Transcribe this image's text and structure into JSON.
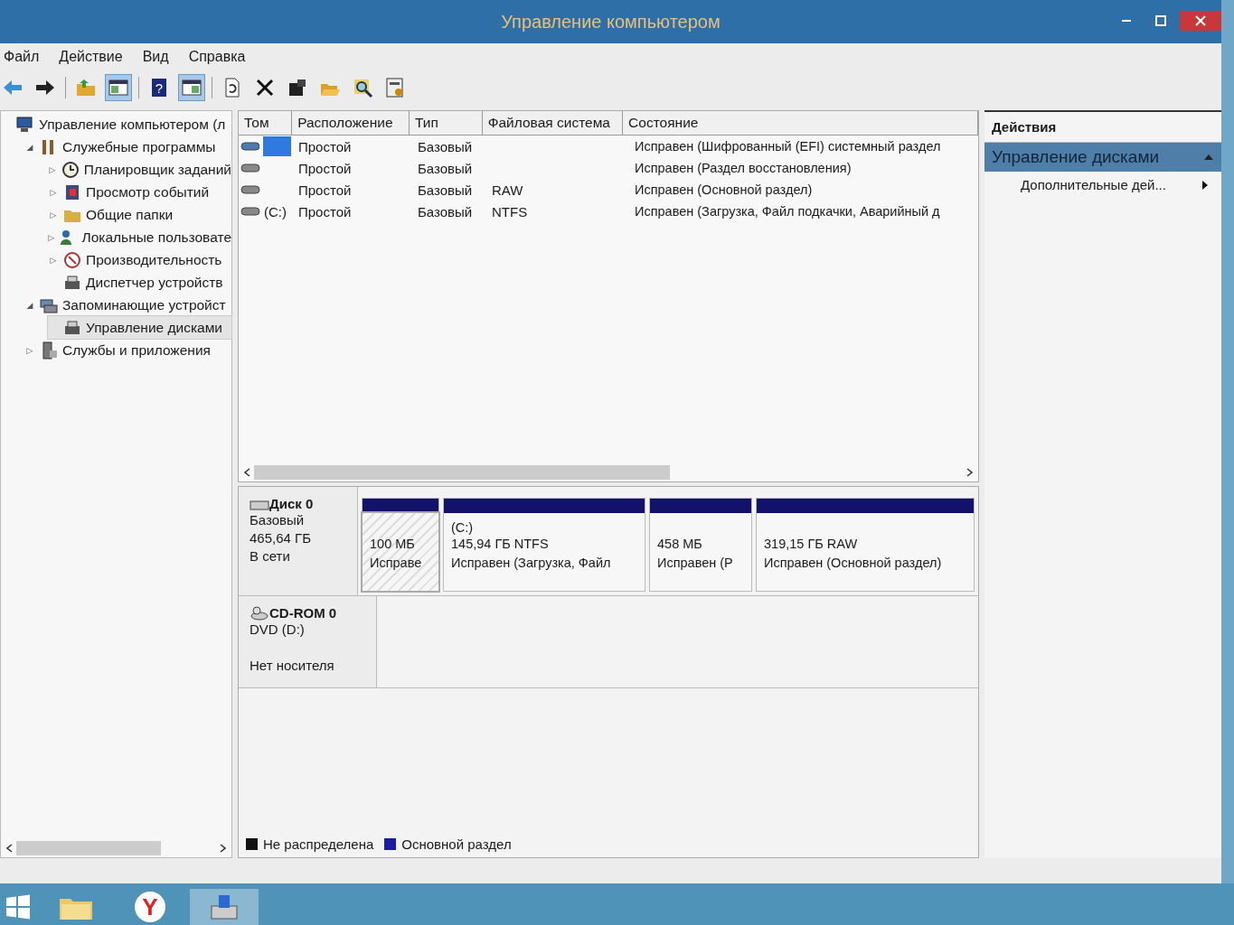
{
  "window": {
    "title": "Управление компьютером"
  },
  "menu": [
    "Файл",
    "Действие",
    "Вид",
    "Справка"
  ],
  "toolbar": [
    {
      "kind": "back",
      "selected": false
    },
    {
      "kind": "forward",
      "selected": false
    },
    {
      "kind": "sep"
    },
    {
      "kind": "folder-up",
      "selected": false
    },
    {
      "kind": "pane-left",
      "selected": true
    },
    {
      "kind": "sep"
    },
    {
      "kind": "help",
      "glyph": "?",
      "selected": false
    },
    {
      "kind": "pane-right",
      "selected": true
    },
    {
      "kind": "sep"
    },
    {
      "kind": "refresh",
      "selected": false
    },
    {
      "kind": "delete",
      "selected": false
    },
    {
      "kind": "properties",
      "selected": false
    },
    {
      "kind": "open",
      "selected": false
    },
    {
      "kind": "find",
      "selected": false
    },
    {
      "kind": "settings",
      "selected": false
    }
  ],
  "tree": [
    {
      "label": "Управление компьютером (л",
      "selected": false,
      "children": [
        {
          "label": "Служебные программы",
          "toggle": "◢",
          "selected": false,
          "children": [
            {
              "label": "Планировщик заданий",
              "toggle": "▷",
              "selected": false
            },
            {
              "label": "Просмотр событий",
              "toggle": "▷",
              "selected": false
            },
            {
              "label": "Общие папки",
              "toggle": "▷",
              "selected": false
            },
            {
              "label": "Локальные пользовате",
              "toggle": "▷",
              "selected": false
            },
            {
              "label": "Производительность",
              "toggle": "▷",
              "selected": false
            },
            {
              "label": "Диспетчер устройств",
              "selected": false
            }
          ]
        },
        {
          "label": "Запоминающие устройст",
          "toggle": "◢",
          "selected": false,
          "children": [
            {
              "label": "Управление дисками",
              "selected": true
            }
          ]
        },
        {
          "label": "Службы и приложения",
          "toggle": "▷",
          "selected": false
        }
      ]
    }
  ],
  "table": {
    "columns": [
      "Том",
      "Расположение",
      "Тип",
      "Файловая система",
      "Состояние"
    ],
    "rows": [
      {
        "layout": "Простой",
        "type": "Базовый",
        "status": "Исправен (Шифрованный (EFI) системный раздел",
        "selected": true
      },
      {
        "layout": "Простой",
        "type": "Базовый",
        "status": "Исправен (Раздел восстановления)",
        "selected": false
      },
      {
        "layout": "Простой",
        "type": "Базовый",
        "fs": "RAW",
        "status": "Исправен (Основной раздел)",
        "selected": false
      },
      {
        "volume": "(C:)",
        "layout": "Простой",
        "type": "Базовый",
        "fs": "NTFS",
        "status": "Исправен (Загрузка, Файл подкачки, Аварийный д",
        "selected": false
      }
    ]
  },
  "disks": [
    {
      "kind": "hdd",
      "name": "Диск 0",
      "lines": [
        "Базовый",
        "465,64 ГБ",
        "В сети"
      ],
      "partitions": [
        {
          "size": "100 МБ",
          "status": "Исправе",
          "selected": true
        },
        {
          "label": "(C:)",
          "size": "145,94 ГБ NTFS",
          "status": "Исправен (Загрузка, Файл",
          "selected": false
        },
        {
          "size": "458 МБ",
          "status": "Исправен (Р",
          "selected": false
        },
        {
          "size": "319,15 ГБ RAW",
          "status": "Исправен (Основной раздел)",
          "selected": false
        }
      ]
    },
    {
      "kind": "cdrom",
      "name": "CD-ROM 0",
      "lines": [
        "DVD (D:)"
      ],
      "note": "Нет носителя"
    }
  ],
  "legend": [
    {
      "label": "Не распределена",
      "color": "#111111"
    },
    {
      "label": "Основной раздел",
      "color": "#1c1ca8"
    }
  ],
  "actions": {
    "title": "Действия",
    "section": "Управление дисками",
    "items": [
      "Дополнительные дей..."
    ]
  },
  "taskbar": [
    {
      "kind": "start",
      "selected": false
    },
    {
      "kind": "explorer",
      "selected": false
    },
    {
      "kind": "browser",
      "text": "Y",
      "selected": false
    },
    {
      "kind": "disk-mgmt",
      "selected": true
    }
  ]
}
